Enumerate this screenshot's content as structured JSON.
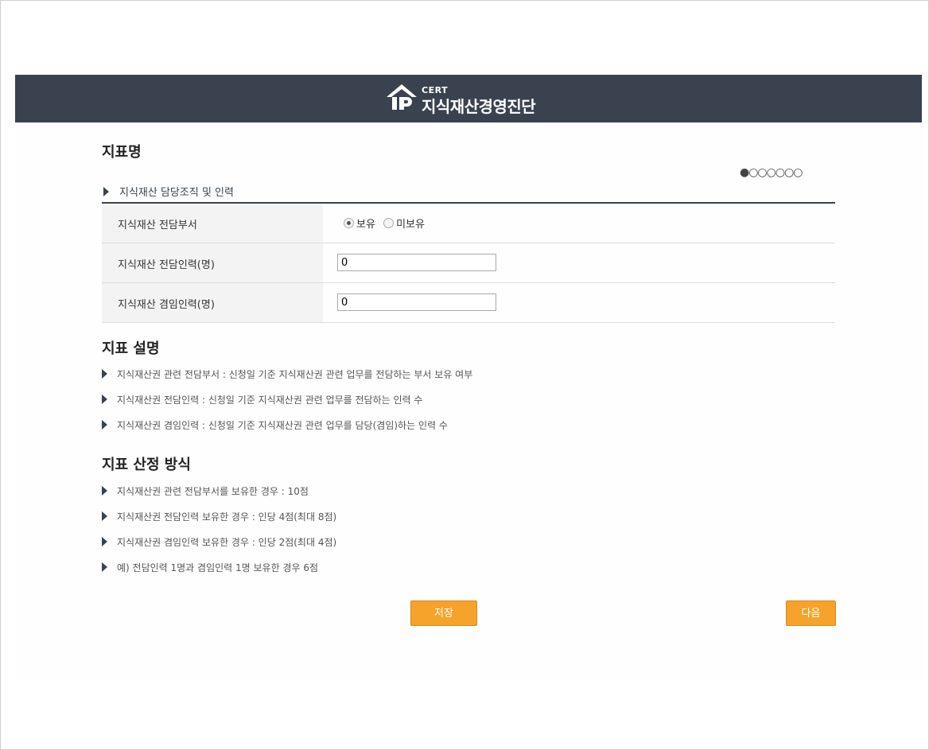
{
  "header": {
    "logo_sup": "CERT",
    "logo_text": "지식재산경영진단"
  },
  "indicator": {
    "title": "지표명",
    "progress": "●○○○○○○",
    "section_label": "지식재산 담당조직 및 인력",
    "fields": {
      "dept": {
        "label": "지식재산 전담부서",
        "options": [
          "보유",
          "미보유"
        ],
        "selected": "보유"
      },
      "dedicated_staff": {
        "label": "지식재산 전담인력(명)",
        "value": "0"
      },
      "concurrent_staff": {
        "label": "지식재산 겸임인력(명)",
        "value": "0"
      }
    }
  },
  "description": {
    "title": "지표 설명",
    "items": [
      "지식재산권 관련 전담부서 : 신청일 기준 지식재산권 관련 업무를 전담하는 부서 보유 여부",
      "지식재산권 전담인력 : 신청일 기준 지식재산권 관련 업무를 전담하는 인력 수",
      "지식재산권 겸임인력 : 신청일 기준 지식재산권 관련 업무를 담당(겸임)하는 인력 수"
    ]
  },
  "method": {
    "title": "지표 산정 방식",
    "items": [
      "지식재산권 관련 전담부서를 보유한 경우 : 10점",
      "지식재산권 전담인력 보유한 경우 : 인당 4점(최대 8점)",
      "지식재산권 겸임인력 보유한 경우 : 인당 2점(최대 4점)",
      "예) 전담인력 1명과 겸임인력 1명 보유한 경우 6점"
    ]
  },
  "buttons": {
    "save": "저장",
    "next": "다음"
  },
  "colors": {
    "header": "#3a4250",
    "button": "#f5a32a"
  }
}
